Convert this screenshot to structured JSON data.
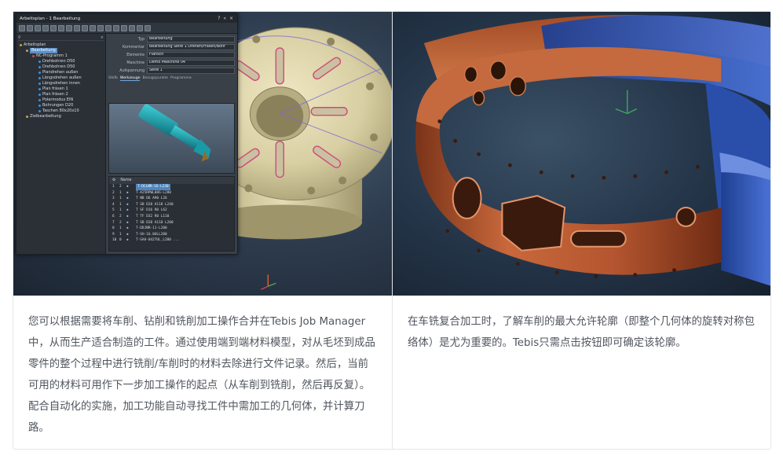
{
  "cards": [
    {
      "image": {
        "window_title": "Arbeitsplan - 1 Bearbeitung",
        "window_controls": "? « ×",
        "tree": {
          "search_close": "×",
          "items": [
            {
              "label": "Arbeitsplan",
              "depth": 0,
              "icon": "folder-icon",
              "selected": false
            },
            {
              "label": "Bearbeitung",
              "depth": 1,
              "icon": "gear-icon",
              "selected": true
            },
            {
              "label": "NC-Programm 1",
              "depth": 2,
              "icon": "program-icon",
              "selected": false
            },
            {
              "label": "Drehbohren D50",
              "depth": 3,
              "icon": "operation-icon",
              "selected": false
            },
            {
              "label": "Drehbohren D50",
              "depth": 3,
              "icon": "operation-icon",
              "selected": false
            },
            {
              "label": "Plandrehen außen",
              "depth": 3,
              "icon": "operation-icon",
              "selected": false
            },
            {
              "label": "Längsdrehen außen",
              "depth": 3,
              "icon": "operation-icon",
              "selected": false
            },
            {
              "label": "Längsdrehen innen",
              "depth": 3,
              "icon": "operation-icon",
              "selected": false
            },
            {
              "label": "Plan fräsen 1",
              "depth": 3,
              "icon": "operation-icon",
              "selected": false
            },
            {
              "label": "Plan fräsen 2",
              "depth": 3,
              "icon": "operation-icon",
              "selected": false
            },
            {
              "label": "Polarmodus EIN",
              "depth": 3,
              "icon": "operation-icon",
              "selected": false
            },
            {
              "label": "Bohrungen D20",
              "depth": 3,
              "icon": "operation-icon",
              "selected": false
            },
            {
              "label": "Taschen 80x20x10",
              "depth": 3,
              "icon": "operation-icon",
              "selected": false
            },
            {
              "label": "Zielbearbeitung",
              "depth": 1,
              "icon": "gear-icon",
              "selected": false
            }
          ]
        },
        "properties": [
          {
            "key": "Typ",
            "value": "Bearbeitung"
          },
          {
            "key": "Kommentar",
            "value": "Bearbeitung Seite 1 Drehen/Fräsen/Bohr"
          },
          {
            "key": "Elemente",
            "value": "Flansch"
          },
          {
            "key": "Maschine",
            "value": "Demo Maschine 04"
          },
          {
            "key": "Aufspannung",
            "value": "Seite 1"
          }
        ],
        "tabs": [
          "Stkfb",
          "Werkzeuge",
          "Bezugspunkte",
          "Programme"
        ],
        "active_tab": "Werkzeuge",
        "tool_list": {
          "header": "Name",
          "rows": [
            {
              "n": "1",
              "s": "2",
              "name": "T-DCLNR-16-L230",
              "selected": true
            },
            {
              "n": "2",
              "s": "1",
              "name": "T-A25RPWL086-L280",
              "selected": false
            },
            {
              "n": "3",
              "s": "1",
              "name": "T NB D6 A90 L26",
              "selected": false
            },
            {
              "n": "4",
              "s": "1",
              "name": "T SB D20 A118 L240",
              "selected": false
            },
            {
              "n": "5",
              "s": "1",
              "name": "T SF D16 R0 L62",
              "selected": false
            },
            {
              "n": "6",
              "s": "2",
              "name": "T TF D32 R0 L110",
              "selected": false
            },
            {
              "n": "7",
              "s": "2",
              "name": "T SB D20 A118 L200",
              "selected": false
            },
            {
              "n": "8",
              "s": "1",
              "name": "T-DDJNR-11-L200",
              "selected": false
            },
            {
              "n": "9",
              "s": "1",
              "name": "T-SH-16.0ULL200",
              "selected": false
            },
            {
              "n": "10",
              "s": "0",
              "name": "T-SAH-0427UL_L200 ...",
              "selected": false
            }
          ]
        }
      },
      "text": "您可以根据需要将车削、钻削和铣削加工操作合并在Tebis Job Manager中，从而生产适合制造的工件。通过使用端到端材料模型，对从毛坯到成品零件的整个过程中进行铣削/车削时的材料去除进行文件记录。然后，当前可用的材料可用作下一步加工操作的起点（从车削到铣削，然后再反复）。配合自动化的实施，加工功能自动寻找工件中需加工的几何体，并计算刀路。"
    },
    {
      "text": "在车铣复合加工时，了解车削的最大允许轮廓（即整个几何体的旋转对称包络体）是尤为重要的。Tebis只需点击按钮即可确定该轮廓。"
    }
  ],
  "colors": {
    "card_border": "#e4e6ea",
    "body_text": "#50555e",
    "part_copper": "#b4552f",
    "part_blue": "#2f57b8",
    "flange_beige": "#d8cfa3",
    "selection_blue": "#4f86c0"
  }
}
